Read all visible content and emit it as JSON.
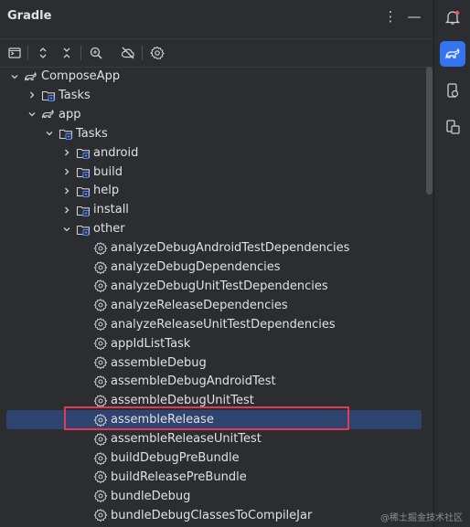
{
  "panel": {
    "title": "Gradle"
  },
  "header": {
    "options_icon": "more-vertical-icon",
    "minimize_icon": "minimize-icon"
  },
  "toolbar": [
    {
      "name": "show-task-list-button",
      "icon": "console-icon"
    },
    {
      "name": "expand-all-button",
      "icon": "expand-all-icon"
    },
    {
      "name": "collapse-all-button",
      "icon": "collapse-all-icon"
    },
    {
      "name": "analyze-dependencies-button",
      "icon": "dependencies-icon"
    },
    {
      "name": "toggle-offline-mode-button",
      "icon": "offline-cloud-icon"
    },
    {
      "name": "build-settings-button",
      "icon": "gear-icon"
    }
  ],
  "tree": [
    {
      "label": "ComposeApp",
      "depth": 0,
      "type": "project",
      "expanded": true
    },
    {
      "label": "Tasks",
      "depth": 1,
      "type": "folder",
      "expanded": false
    },
    {
      "label": "app",
      "depth": 1,
      "type": "project",
      "expanded": true
    },
    {
      "label": "Tasks",
      "depth": 2,
      "type": "folder",
      "expanded": true
    },
    {
      "label": "android",
      "depth": 3,
      "type": "folder",
      "expanded": false
    },
    {
      "label": "build",
      "depth": 3,
      "type": "folder",
      "expanded": false
    },
    {
      "label": "help",
      "depth": 3,
      "type": "folder",
      "expanded": false
    },
    {
      "label": "install",
      "depth": 3,
      "type": "folder",
      "expanded": false
    },
    {
      "label": "other",
      "depth": 3,
      "type": "folder",
      "expanded": true
    },
    {
      "label": "analyzeDebugAndroidTestDependencies",
      "depth": 4,
      "type": "task"
    },
    {
      "label": "analyzeDebugDependencies",
      "depth": 4,
      "type": "task"
    },
    {
      "label": "analyzeDebugUnitTestDependencies",
      "depth": 4,
      "type": "task"
    },
    {
      "label": "analyzeReleaseDependencies",
      "depth": 4,
      "type": "task"
    },
    {
      "label": "analyzeReleaseUnitTestDependencies",
      "depth": 4,
      "type": "task"
    },
    {
      "label": "appIdListTask",
      "depth": 4,
      "type": "task"
    },
    {
      "label": "assembleDebug",
      "depth": 4,
      "type": "task"
    },
    {
      "label": "assembleDebugAndroidTest",
      "depth": 4,
      "type": "task"
    },
    {
      "label": "assembleDebugUnitTest",
      "depth": 4,
      "type": "task"
    },
    {
      "label": "assembleRelease",
      "depth": 4,
      "type": "task",
      "selected": true
    },
    {
      "label": "assembleReleaseUnitTest",
      "depth": 4,
      "type": "task"
    },
    {
      "label": "buildDebugPreBundle",
      "depth": 4,
      "type": "task"
    },
    {
      "label": "buildReleasePreBundle",
      "depth": 4,
      "type": "task"
    },
    {
      "label": "bundleDebug",
      "depth": 4,
      "type": "task"
    },
    {
      "label": "bundleDebugClassesToCompileJar",
      "depth": 4,
      "type": "task"
    }
  ],
  "right_rail": [
    {
      "name": "notifications-button",
      "icon": "bell-icon",
      "active": false
    },
    {
      "name": "gradle-tool-button",
      "icon": "gradle-elephant-icon",
      "active": true
    },
    {
      "name": "device-manager-button",
      "icon": "device-manager-icon",
      "active": false
    },
    {
      "name": "running-devices-button",
      "icon": "running-devices-icon",
      "active": false
    }
  ],
  "watermark": "@稀土掘金技术社区",
  "colors": {
    "background": "#2b2d30",
    "selection": "#2e436e",
    "accent": "#3574f0",
    "highlight_box": "#e03b54"
  }
}
